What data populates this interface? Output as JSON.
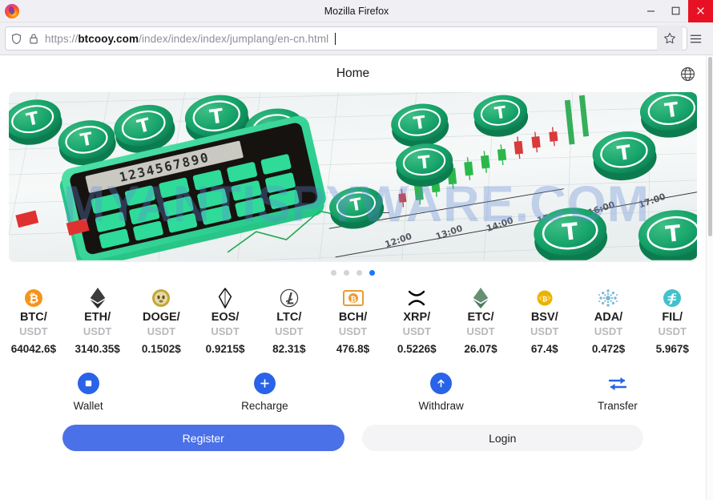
{
  "browser": {
    "window_title": "Mozilla Firefox",
    "logo_icon": "firefox-logo",
    "controls": {
      "minimize": "minimize-icon",
      "maximize": "maximize-icon",
      "close": "close-icon"
    },
    "url": {
      "scheme": "https://",
      "domain": "btcooy.com",
      "path": "/index/index/index/jumplang/en-cn.html",
      "full": "https://btcooy.com/index/index/index/jumplang/en-cn.html",
      "shield_icon": "shield-icon",
      "lock_icon": "padlock-icon"
    },
    "bookmark_icon": "star-icon",
    "menu_icon": "hamburger-menu-icon"
  },
  "page": {
    "header": {
      "title": "Home",
      "language_icon": "globe-icon"
    },
    "banner": {
      "alt": "3d-tether-coins-calculator-candlestick-chart-banner",
      "chart_time_labels": [
        "12:00",
        "13:00",
        "14:00",
        "15:00",
        "16:00",
        "17:00"
      ],
      "calculator_display": "1234567890"
    },
    "carousel": {
      "total_dots": 4,
      "active_index": 3
    },
    "tickers": [
      {
        "icon": "bitcoin-icon",
        "base": "BTC/",
        "quote": "USDT",
        "price": "64042.6$",
        "color": "#f7931a"
      },
      {
        "icon": "ethereum-icon",
        "base": "ETH/",
        "quote": "USDT",
        "price": "3140.35$",
        "color": "#3c3c3d"
      },
      {
        "icon": "dogecoin-icon",
        "base": "DOGE/",
        "quote": "USDT",
        "price": "0.1502$",
        "color": "#c3a634"
      },
      {
        "icon": "eos-icon",
        "base": "EOS/",
        "quote": "USDT",
        "price": "0.9215$",
        "color": "#1a1a1a"
      },
      {
        "icon": "litecoin-icon",
        "base": "LTC/",
        "quote": "USDT",
        "price": "82.31$",
        "color": "#345d9d"
      },
      {
        "icon": "bitcoin-cash-icon",
        "base": "BCH/",
        "quote": "USDT",
        "price": "476.8$",
        "color": "#eb9b33"
      },
      {
        "icon": "ripple-icon",
        "base": "XRP/",
        "quote": "USDT",
        "price": "0.5226$",
        "color": "#000000"
      },
      {
        "icon": "ethereum-classic-icon",
        "base": "ETC/",
        "quote": "USDT",
        "price": "26.07$",
        "color": "#669073"
      },
      {
        "icon": "bitcoin-sv-icon",
        "base": "BSV/",
        "quote": "USDT",
        "price": "67.4$",
        "color": "#eab300"
      },
      {
        "icon": "cardano-icon",
        "base": "ADA/",
        "quote": "USDT",
        "price": "0.472$",
        "color": "#7bb8d4"
      },
      {
        "icon": "filecoin-icon",
        "base": "FIL/",
        "quote": "USDT",
        "price": "5.967$",
        "color": "#42c1ca"
      }
    ],
    "actions": [
      {
        "icon": "wallet-icon",
        "label": "Wallet"
      },
      {
        "icon": "plus-icon",
        "label": "Recharge"
      },
      {
        "icon": "arrow-up-icon",
        "label": "Withdraw"
      },
      {
        "icon": "transfer-arrows-icon",
        "label": "Transfer"
      }
    ],
    "auth": {
      "register_label": "Register",
      "login_label": "Login"
    },
    "watermark": "MYANTISPYWARE.COM",
    "colors": {
      "accent_blue": "#2a63e8",
      "register_blue": "#4b71e8",
      "carousel_active": "#1677ff",
      "quote_gray": "#b9b9bd"
    }
  }
}
